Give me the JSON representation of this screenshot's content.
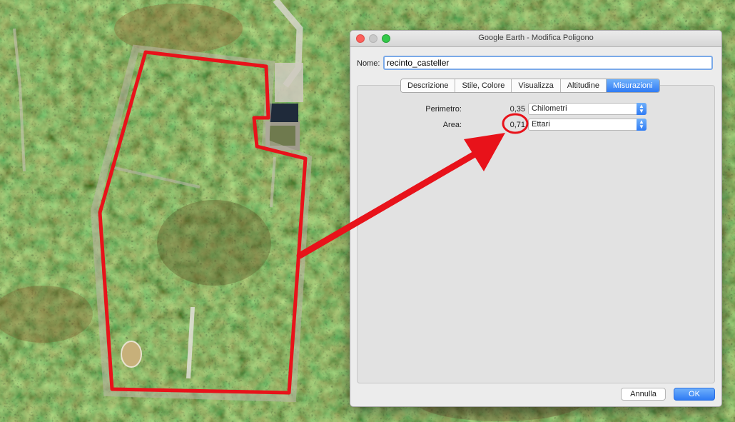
{
  "window": {
    "title": "Google Earth - Modifica Poligono"
  },
  "form": {
    "name_label": "Nome:",
    "name_value": "recinto_casteller"
  },
  "tabs": [
    {
      "label": "Descrizione",
      "active": false
    },
    {
      "label": "Stile, Colore",
      "active": false
    },
    {
      "label": "Visualizza",
      "active": false
    },
    {
      "label": "Altitudine",
      "active": false
    },
    {
      "label": "Misurazioni",
      "active": true
    }
  ],
  "measurements": {
    "perimeter": {
      "label": "Perimetro:",
      "value": "0,35",
      "unit": "Chilometri"
    },
    "area": {
      "label": "Area:",
      "value": "0,71",
      "unit": "Ettari"
    }
  },
  "buttons": {
    "cancel": "Annulla",
    "ok": "OK"
  },
  "colors": {
    "annotation_red": "#e8121a",
    "accent_blue": "#2f7bf4"
  }
}
